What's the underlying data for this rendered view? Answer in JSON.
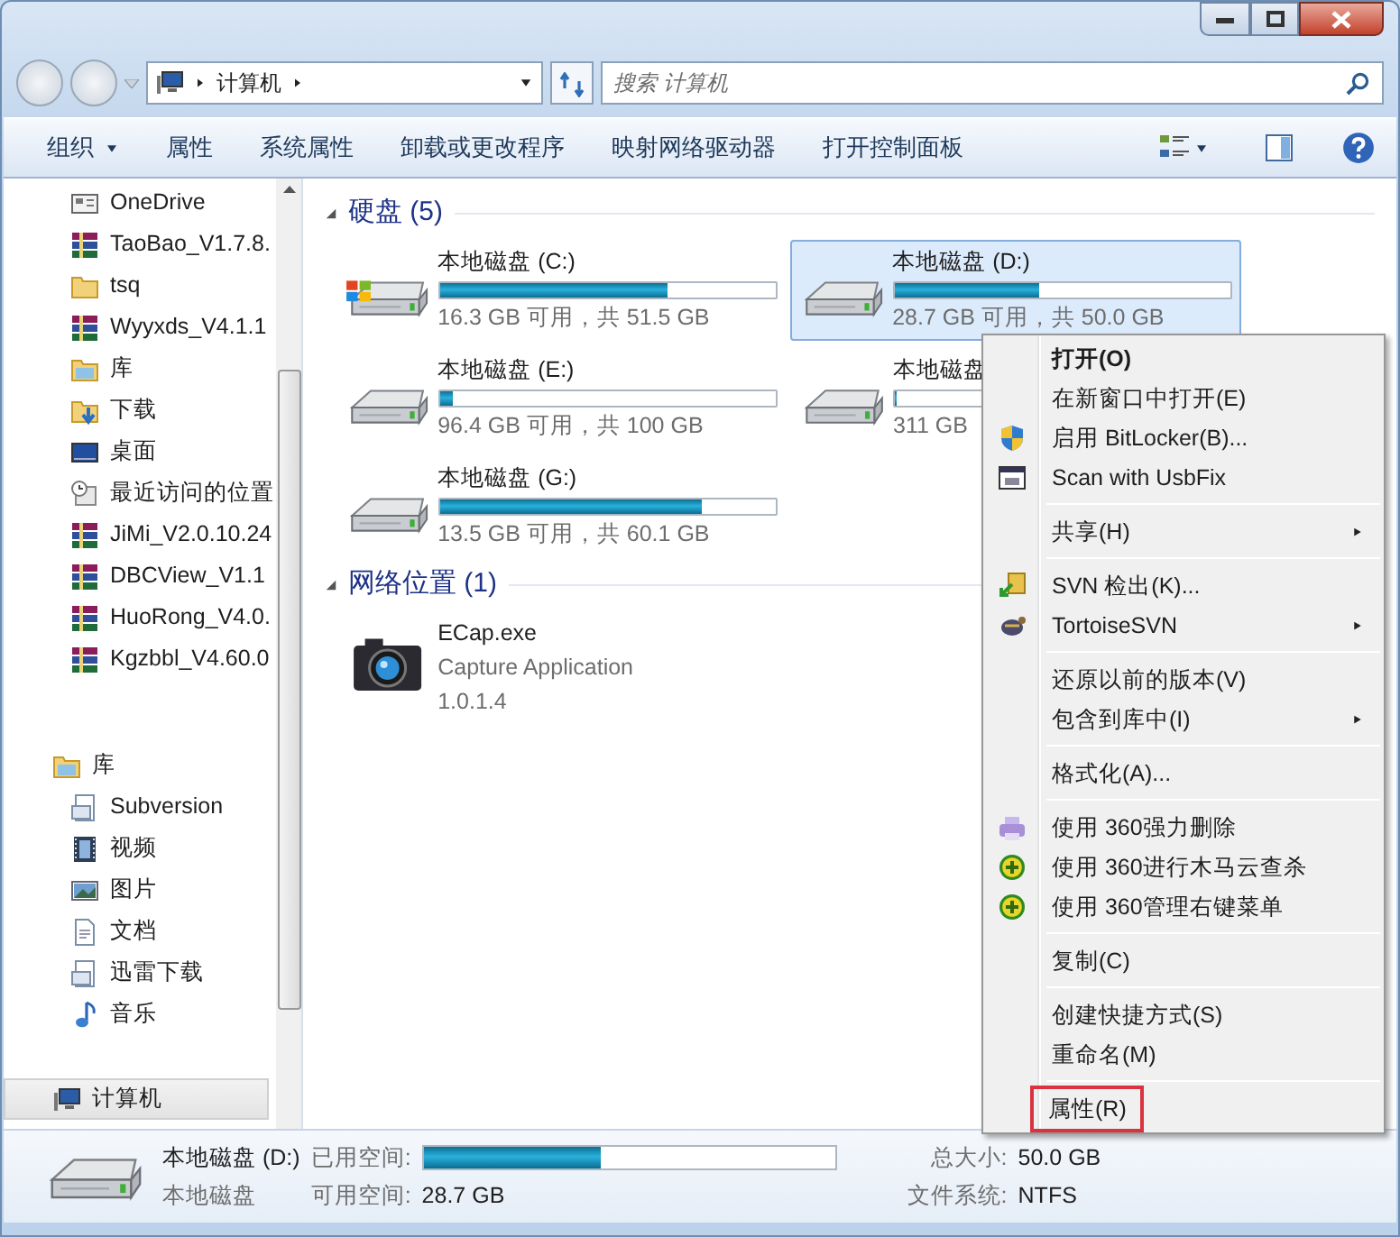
{
  "address": {
    "path": [
      "计算机"
    ]
  },
  "search": {
    "placeholder": "搜索 计算机"
  },
  "toolbar": {
    "buttons": [
      {
        "label": "组织",
        "dropdown": true
      },
      {
        "label": "属性",
        "dropdown": false
      },
      {
        "label": "系统属性",
        "dropdown": false
      },
      {
        "label": "卸载或更改程序",
        "dropdown": false
      },
      {
        "label": "映射网络驱动器",
        "dropdown": false
      },
      {
        "label": "打开控制面板",
        "dropdown": false
      }
    ]
  },
  "nav": {
    "favorites": [
      {
        "label": "OneDrive",
        "kind": "onedrive"
      },
      {
        "label": "TaoBao_V1.7.8.",
        "kind": "archive"
      },
      {
        "label": "tsq",
        "kind": "folder"
      },
      {
        "label": "Wyyxds_V4.1.1",
        "kind": "archive"
      },
      {
        "label": "库",
        "kind": "library"
      },
      {
        "label": "下载",
        "kind": "download"
      },
      {
        "label": "桌面",
        "kind": "desktop"
      },
      {
        "label": "最近访问的位置",
        "kind": "recent"
      },
      {
        "label": "JiMi_V2.0.10.24",
        "kind": "archive"
      },
      {
        "label": "DBCView_V1.1",
        "kind": "archive"
      },
      {
        "label": "HuoRong_V4.0.",
        "kind": "archive"
      },
      {
        "label": "Kgzbbl_V4.60.0",
        "kind": "archive"
      }
    ],
    "libraries": {
      "label": "库",
      "kind": "library",
      "children": [
        {
          "label": "Subversion",
          "kind": "doclib"
        },
        {
          "label": "视频",
          "kind": "video"
        },
        {
          "label": "图片",
          "kind": "picture"
        },
        {
          "label": "文档",
          "kind": "document"
        },
        {
          "label": "迅雷下载",
          "kind": "doclib"
        },
        {
          "label": "音乐",
          "kind": "music"
        }
      ]
    },
    "computer": {
      "label": "计算机",
      "kind": "computer",
      "selected": true
    }
  },
  "groups": [
    {
      "title": "硬盘 (5)",
      "expanded": true,
      "items": [
        {
          "kind": "drive",
          "system": true,
          "name": "本地磁盘 (C:)",
          "level": 0.68,
          "info": "16.3 GB 可用，共 51.5 GB",
          "selected": false
        },
        {
          "kind": "drive",
          "system": false,
          "name": "本地磁盘 (D:)",
          "level": 0.43,
          "info": "28.7 GB 可用，共 50.0 GB",
          "selected": true
        },
        {
          "kind": "drive",
          "system": false,
          "name": "本地磁盘 (E:)",
          "level": 0.04,
          "info": "96.4 GB 可用，共 100 GB",
          "selected": false
        },
        {
          "kind": "drive",
          "system": false,
          "name": "本地磁盘",
          "level": 0.02,
          "info": "311 GB",
          "selected": false
        },
        {
          "kind": "drive",
          "system": false,
          "name": "本地磁盘 (G:)",
          "level": 0.78,
          "info": "13.5 GB 可用，共 60.1 GB",
          "selected": false
        }
      ]
    },
    {
      "title": "网络位置 (1)",
      "expanded": true,
      "items": [
        {
          "kind": "app",
          "name": "ECap.exe",
          "lines": [
            "Capture Application",
            "1.0.1.4"
          ],
          "selected": false
        }
      ]
    }
  ],
  "menu": {
    "groups": [
      [
        {
          "label": "打开(O)",
          "kind": "plain",
          "bold": true,
          "submenu": false,
          "outlined": false
        },
        {
          "label": "在新窗口中打开(E)",
          "kind": "plain",
          "bold": false,
          "submenu": false,
          "outlined": false
        },
        {
          "label": "启用 BitLocker(B)...",
          "kind": "shield",
          "bold": false,
          "submenu": false,
          "outlined": false
        },
        {
          "label": "Scan with UsbFix",
          "kind": "window",
          "bold": false,
          "submenu": false,
          "outlined": false
        }
      ],
      [
        {
          "label": "共享(H)",
          "kind": "plain",
          "bold": false,
          "submenu": true,
          "outlined": false
        }
      ],
      [
        {
          "label": "SVN 检出(K)...",
          "kind": "checkout",
          "bold": false,
          "submenu": false,
          "outlined": false
        },
        {
          "label": "TortoiseSVN",
          "kind": "turtle",
          "bold": false,
          "submenu": true,
          "outlined": false
        }
      ],
      [
        {
          "label": "还原以前的版本(V)",
          "kind": "plain",
          "bold": false,
          "submenu": false,
          "outlined": false
        },
        {
          "label": "包含到库中(I)",
          "kind": "plain",
          "bold": false,
          "submenu": true,
          "outlined": false
        }
      ],
      [
        {
          "label": "格式化(A)...",
          "kind": "plain",
          "bold": false,
          "submenu": false,
          "outlined": false
        }
      ],
      [
        {
          "label": "使用 360强力删除",
          "kind": "printer",
          "bold": false,
          "submenu": false,
          "outlined": false
        },
        {
          "label": "使用 360进行木马云查杀",
          "kind": "plus",
          "bold": false,
          "submenu": false,
          "outlined": false
        },
        {
          "label": "使用 360管理右键菜单",
          "kind": "plus",
          "bold": false,
          "submenu": false,
          "outlined": false
        }
      ],
      [
        {
          "label": "复制(C)",
          "kind": "plain",
          "bold": false,
          "submenu": false,
          "outlined": false
        }
      ],
      [
        {
          "label": "创建快捷方式(S)",
          "kind": "plain",
          "bold": false,
          "submenu": false,
          "outlined": false
        },
        {
          "label": "重命名(M)",
          "kind": "plain",
          "bold": false,
          "submenu": false,
          "outlined": false
        }
      ],
      [
        {
          "label": "属性(R)",
          "kind": "plain",
          "bold": false,
          "submenu": false,
          "outlined": true
        }
      ]
    ]
  },
  "status": {
    "name": "本地磁盘 (D:)",
    "type": "本地磁盘",
    "used_label": "已用空间:",
    "level": 0.43,
    "free_label": "可用空间:",
    "free": "28.7 GB",
    "total_label": "总大小:",
    "total": "50.0 GB",
    "fs_label": "文件系统:",
    "fs": "NTFS"
  }
}
